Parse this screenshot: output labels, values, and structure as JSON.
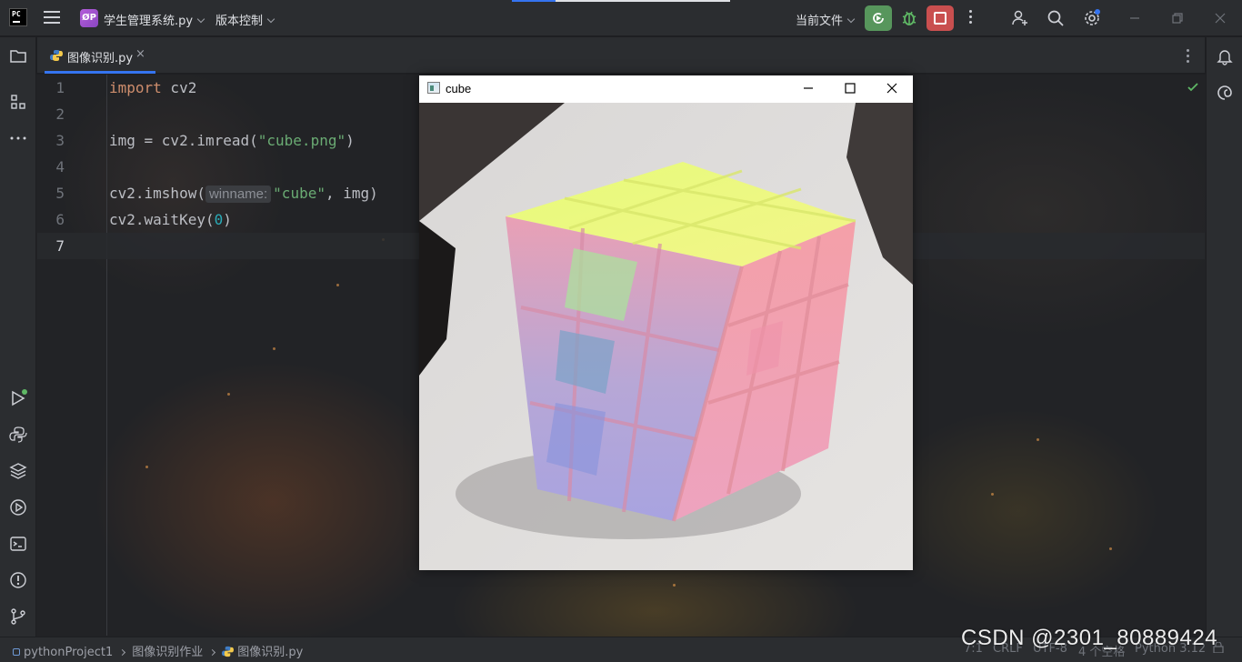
{
  "titlebar": {
    "project_badge": "ØP",
    "project_name": "学生管理系统.py",
    "vcs_label": "版本控制",
    "run_config": "当前文件"
  },
  "tab": {
    "file_name": "图像识别.py"
  },
  "editor": {
    "lines": [
      {
        "num": "1"
      },
      {
        "num": "2"
      },
      {
        "num": "3"
      },
      {
        "num": "4"
      },
      {
        "num": "5"
      },
      {
        "num": "6"
      },
      {
        "num": "7"
      }
    ],
    "code": {
      "l1_kw": "import",
      "l1_rest": " cv2",
      "l3_a": "img = cv2.imread(",
      "l3_str": "\"cube.png\"",
      "l3_b": ")",
      "l5_a": "cv2.imshow(",
      "l5_hint": "winname:",
      "l5_str": "\"cube\"",
      "l5_b": ", img)",
      "l6_a": "cv2.waitKey(",
      "l6_num": "0",
      "l6_b": ")"
    }
  },
  "cv_window": {
    "title": "cube"
  },
  "statusbar": {
    "crumb_project": "pythonProject1",
    "crumb_folder": "图像识别作业",
    "crumb_file": "图像识别.py",
    "pos": "7:1",
    "line_sep": "CRLF",
    "encoding": "UTF-8",
    "indent": "4 个空格",
    "interpreter": "Python 3.12"
  },
  "watermark": "CSDN @2301_80889424",
  "colors": {
    "accent": "#3574f0",
    "run": "#57965c",
    "stop": "#c94f4f"
  }
}
